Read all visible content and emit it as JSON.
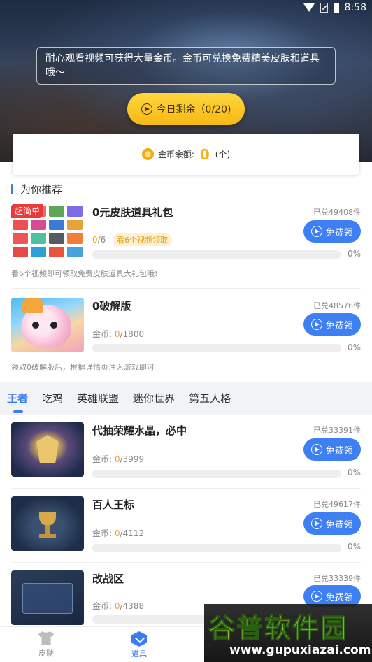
{
  "status_bar": {
    "time": "8:58"
  },
  "hero": {
    "notice": "耐心观看视频可获得大量金币。金币可兑换免费精美皮肤和道具哦～",
    "today_button": "今日剩余（0/20)"
  },
  "balance": {
    "label": "金币余额:",
    "value": "0",
    "unit": "(个)"
  },
  "recommend": {
    "title": "为你推荐",
    "items": [
      {
        "badge": "超简单",
        "title": "0元皮肤道具礼包",
        "redeemed": "已兑49408件",
        "button": "免费领",
        "progress_current": "0",
        "progress_total": "/6",
        "pill": "看6个视频领取",
        "percent": "0%",
        "progress": 0,
        "desc": "看6个视频即可领取免费皮肤道具大礼包哦!"
      },
      {
        "title": "0破解版",
        "redeemed": "已兑48576件",
        "button": "免费领",
        "progress_prefix": "金币: ",
        "progress_current": "0",
        "progress_total": "/1800",
        "percent": "0%",
        "progress": 0,
        "desc": "领取0破解版后，根据详情页注入游戏即可"
      }
    ]
  },
  "tabs": [
    "王者",
    "吃鸡",
    "英雄联盟",
    "迷你世界",
    "第五人格"
  ],
  "active_tab": "王者",
  "list": [
    {
      "title": "代抽荣耀水晶，必中",
      "redeemed": "已兑33391件",
      "button": "免费领",
      "progress_prefix": "金币: ",
      "progress_current": "0",
      "progress_total": "/3999",
      "percent": "0%",
      "progress": 0
    },
    {
      "title": "百人王标",
      "redeemed": "已兑49617件",
      "button": "免费领",
      "progress_prefix": "金币: ",
      "progress_current": "0",
      "progress_total": "/4112",
      "percent": "0%",
      "progress": 0
    },
    {
      "title": "改战区",
      "redeemed": "已兑33339件",
      "button": "免费领",
      "progress_prefix": "金币: ",
      "progress_current": "0",
      "progress_total": "/4388",
      "percent": "0%",
      "progress": 0
    }
  ],
  "bottom_nav": {
    "skin": "皮肤",
    "tools": "道具",
    "active": "道具"
  },
  "watermark": {
    "big": "谷普软件园",
    "small": "www.gupuxiazai.com"
  },
  "colors": {
    "accent": "#3d7cf0",
    "gold": "#f4b21c",
    "hot": "#e83b3b",
    "button": "#3e7ff3"
  }
}
